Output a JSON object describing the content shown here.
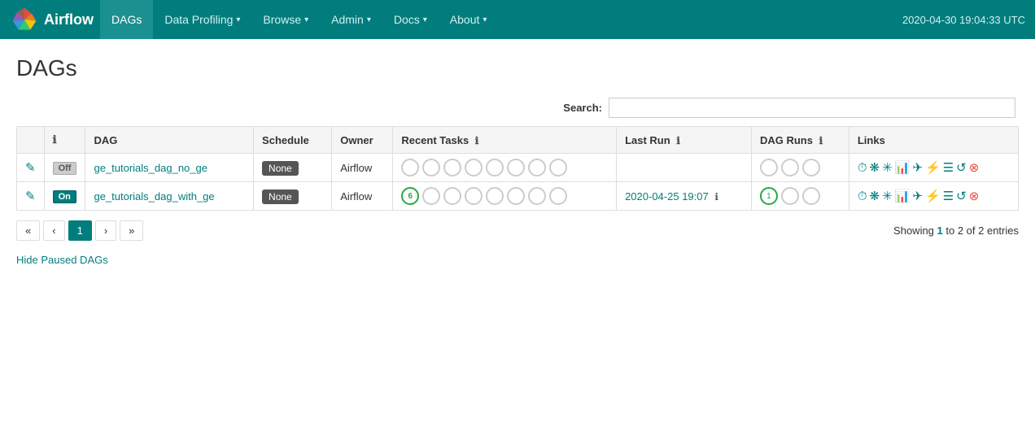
{
  "navbar": {
    "brand": "Airflow",
    "items": [
      {
        "label": "DAGs",
        "active": true,
        "has_dropdown": false
      },
      {
        "label": "Data Profiling",
        "active": false,
        "has_dropdown": true
      },
      {
        "label": "Browse",
        "active": false,
        "has_dropdown": true
      },
      {
        "label": "Admin",
        "active": false,
        "has_dropdown": true
      },
      {
        "label": "Docs",
        "active": false,
        "has_dropdown": true
      },
      {
        "label": "About",
        "active": false,
        "has_dropdown": true
      }
    ],
    "timestamp": "2020-04-30 19:04:33 UTC"
  },
  "page": {
    "title": "DAGs"
  },
  "search": {
    "label": "Search:",
    "placeholder": "",
    "value": ""
  },
  "table": {
    "columns": [
      "",
      "",
      "DAG",
      "Schedule",
      "Owner",
      "Recent Tasks",
      "Last Run",
      "DAG Runs",
      "Links"
    ],
    "rows": [
      {
        "toggle": "Off",
        "toggle_state": "off",
        "dag_name": "ge_tutorials_dag_no_ge",
        "schedule": "None",
        "owner": "Airflow",
        "recent_tasks": [
          null,
          null,
          null,
          null,
          null,
          null,
          null,
          null
        ],
        "recent_task_highlighted": null,
        "last_run": "",
        "dag_runs": [
          null,
          null,
          null
        ],
        "dag_run_highlighted": null
      },
      {
        "toggle": "On",
        "toggle_state": "on",
        "dag_name": "ge_tutorials_dag_with_ge",
        "schedule": "None",
        "owner": "Airflow",
        "recent_tasks": [
          6,
          null,
          null,
          null,
          null,
          null,
          null,
          null
        ],
        "recent_task_highlighted": 0,
        "last_run": "2020-04-25 19:07",
        "dag_runs": [
          1,
          null,
          null
        ],
        "dag_run_highlighted": 0
      }
    ]
  },
  "pagination": {
    "showing_prefix": "Showing ",
    "showing_range": "1",
    "showing_middle": " to 2 of 2 entries",
    "buttons": [
      "«",
      "‹",
      "1",
      "›",
      "»"
    ]
  },
  "footer_link": "Hide Paused DAGs"
}
